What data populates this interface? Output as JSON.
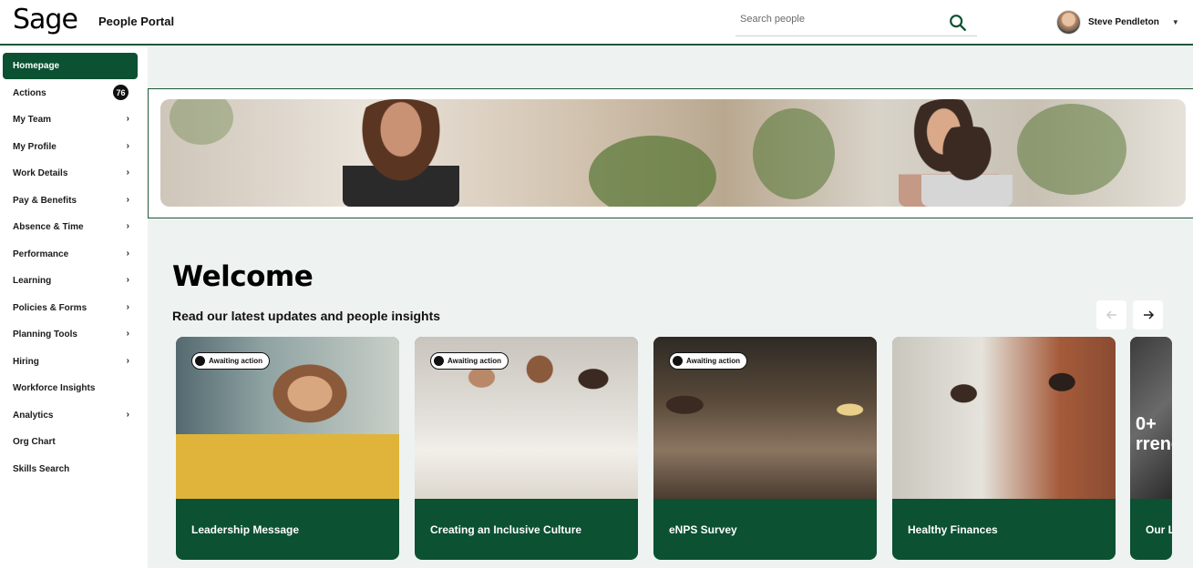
{
  "header": {
    "logo": "Sage",
    "app_title": "People Portal",
    "search_placeholder": "Search people",
    "user_name": "Steve Pendleton"
  },
  "sidebar": {
    "items": [
      {
        "label": "Homepage",
        "active": true
      },
      {
        "label": "Actions",
        "badge": "76"
      },
      {
        "label": "My Team",
        "chevron": true
      },
      {
        "label": "My Profile",
        "chevron": true
      },
      {
        "label": "Work Details",
        "chevron": true
      },
      {
        "label": "Pay & Benefits",
        "chevron": true
      },
      {
        "label": "Absence & Time",
        "chevron": true
      },
      {
        "label": "Performance",
        "chevron": true
      },
      {
        "label": "Learning",
        "chevron": true
      },
      {
        "label": "Policies & Forms",
        "chevron": true
      },
      {
        "label": "Planning Tools",
        "chevron": true
      },
      {
        "label": "Hiring",
        "chevron": true
      },
      {
        "label": "Workforce Insights"
      },
      {
        "label": "Analytics",
        "chevron": true
      },
      {
        "label": "Org Chart"
      },
      {
        "label": "Skills Search"
      }
    ]
  },
  "main": {
    "welcome": "Welcome",
    "subtitle": "Read our latest updates and people insights",
    "cards": [
      {
        "title": "Leadership Message",
        "status": "Awaiting action"
      },
      {
        "title": "Creating an Inclusive Culture",
        "status": "Awaiting action"
      },
      {
        "title": "eNPS Survey",
        "status": "Awaiting action"
      },
      {
        "title": "Healthy Finances"
      },
      {
        "title": "Our L",
        "overlay_text_1": "0+",
        "overlay_text_2": "rrenc"
      }
    ]
  }
}
